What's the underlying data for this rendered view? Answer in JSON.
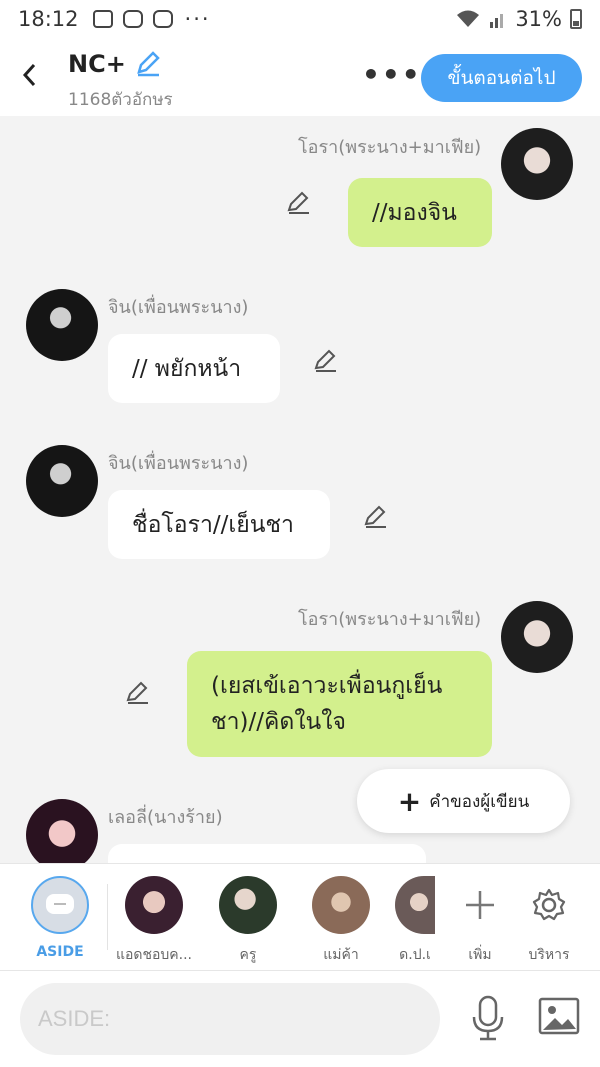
{
  "status_bar": {
    "time": "18:12",
    "dots": "···",
    "battery": "31%"
  },
  "header": {
    "title": "NC+",
    "char_count": "1168ตัวอักษร",
    "next_label": "ขั้นตอนต่อไป",
    "icons": {
      "back": "chevron-left-icon",
      "edit": "pencil-icon",
      "more": "more-horizontal-icon"
    }
  },
  "messages": [
    {
      "side": "right",
      "name": "โอรา(พระนาง+มาเฟีย)",
      "text": "//มองจิน",
      "color": "#d3f08d"
    },
    {
      "side": "left",
      "name": "จิน(เพื่อนพระนาง)",
      "text": "// พยักหน้า",
      "color": "#ffffff"
    },
    {
      "side": "left",
      "name": "จิน(เพื่อนพระนาง)",
      "text": "ชื่อโอรา//เย็นชา",
      "color": "#ffffff"
    },
    {
      "side": "right",
      "name": "โอรา(พระนาง+มาเฟีย)",
      "text_line1": "(เยสเข้เอาวะเพื่อนกูเย็น",
      "text_line2": "ชา)//คิดในใจ",
      "color": "#d3f08d"
    },
    {
      "side": "left",
      "name": "เลอลี่(นางร้าย)",
      "text": "",
      "color": "#ffffff"
    }
  ],
  "author_button": {
    "label": "คำของผู้เขียน",
    "plus": "+"
  },
  "characters": [
    {
      "label": "ASIDE",
      "selected": true
    },
    {
      "label": "แอดชอบค..."
    },
    {
      "label": "ครู"
    },
    {
      "label": "แม่ค้า"
    },
    {
      "label": "ด.ป.เ"
    }
  ],
  "tools": {
    "add_label": "เพิ่ม",
    "manage_label": "บริหาร"
  },
  "input": {
    "placeholder": "ASIDE:"
  },
  "colors": {
    "accent": "#4aa3f5",
    "bubble_green": "#d3f08d",
    "background": "#f3f3f3"
  }
}
